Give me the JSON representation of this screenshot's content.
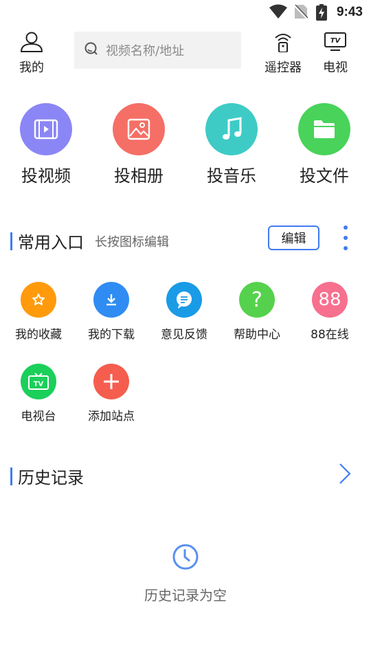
{
  "status_bar": {
    "time": "9:43",
    "icons": [
      "wifi-icon",
      "no-sim-icon",
      "battery-charging-icon"
    ]
  },
  "header": {
    "mine_label": "我的",
    "search_placeholder": "视频名称/地址",
    "remote_label": "遥控器",
    "tv_label": "电视",
    "tv_icon_text": "TV"
  },
  "cast_buttons": [
    {
      "label": "投视频",
      "icon": "video-icon",
      "color": "#8b86f5"
    },
    {
      "label": "投相册",
      "icon": "photo-icon",
      "color": "#f56f66"
    },
    {
      "label": "投音乐",
      "icon": "music-note-icon",
      "color": "#3ecbc6"
    },
    {
      "label": "投文件",
      "icon": "folder-icon",
      "color": "#49d35a"
    }
  ],
  "favorites": {
    "title": "常用入口",
    "subtitle": "长按图标编辑",
    "edit_label": "编辑",
    "items": [
      {
        "label": "我的收藏",
        "icon": "star-icon",
        "color": "#ff9a0d"
      },
      {
        "label": "我的下载",
        "icon": "download-icon",
        "color": "#2f8cf3"
      },
      {
        "label": "意见反馈",
        "icon": "chat-icon",
        "color": "#1a9be6"
      },
      {
        "label": "帮助中心",
        "icon": "question-icon",
        "color": "#56d14d",
        "glyph": "?"
      },
      {
        "label": "88在线",
        "icon": "88-icon",
        "color": "#f7708e",
        "glyph": "88"
      },
      {
        "label": "电视台",
        "icon": "tv-station-icon",
        "color": "#1bcf5b",
        "glyph": "TV"
      },
      {
        "label": "添加站点",
        "icon": "plus-icon",
        "color": "#f55d4f"
      }
    ]
  },
  "history": {
    "title": "历史记录",
    "empty_text": "历史记录为空"
  },
  "colors": {
    "accent": "#3f7bf0"
  }
}
